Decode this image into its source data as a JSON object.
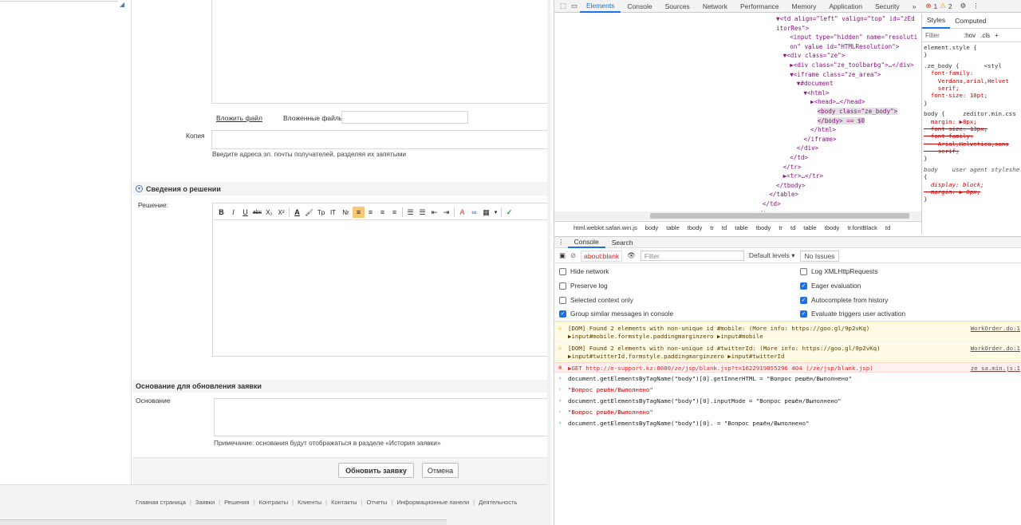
{
  "form": {
    "attach_link": "Вложить файл",
    "attached_files_label": "Вложенные файлы",
    "copy_label": "Копия",
    "copy_hint": "Введите адреса эл. почты получателей, разделяя их запятыми",
    "decision_section": "Сведения о решении",
    "decision_label": "Решение:",
    "editor_toolbar": [
      "B",
      "I",
      "U",
      "abc",
      "X₂",
      "X²",
      "A",
      "🖌",
      "Tp",
      "IT",
      "Nr",
      "≡",
      "≡",
      "≡",
      "≡",
      "☰",
      "☰",
      "⇤",
      "⇥",
      "A",
      "∞",
      "▦",
      "▾",
      "✓"
    ],
    "update_section": "Основание для обновления заявки",
    "reason_label": "Основание",
    "reason_hint": "Примечание: основания будут отображаться в разделе «История заявки»",
    "update_button": "Обновить заявку",
    "cancel_button": "Отмена"
  },
  "footer": {
    "links": [
      "Главная страница",
      "Заявки",
      "Решения",
      "Контракты",
      "Клиенты",
      "Контакты",
      "Отчеты",
      "Информационные панели",
      "Деятельность"
    ]
  },
  "devtools": {
    "tabs": [
      "Elements",
      "Console",
      "Sources",
      "Network",
      "Performance",
      "Memory",
      "Application",
      "Security",
      "»"
    ],
    "active_tab": "Elements",
    "error_count": "1",
    "warning_count": "2",
    "elements_lines": [
      {
        "indent": 0,
        "text": "▼<td align=\"left\" valign=\"top\" id=\"zEd"
      },
      {
        "indent": 0,
        "text": "itorRes\">"
      },
      {
        "indent": 2,
        "text": "<input type=\"hidden\" name=\"resoluti"
      },
      {
        "indent": 2,
        "text": "on\" value id=\"HTMLResolution\">"
      },
      {
        "indent": 1,
        "text": "▼<div class=\"ze\">"
      },
      {
        "indent": 2,
        "text": "▶<div class=\"ze_toolbarbg\">…</div>"
      },
      {
        "indent": 2,
        "text": "▼<iframe class=\"ze_area\">"
      },
      {
        "indent": 3,
        "text": "▼#document"
      },
      {
        "indent": 4,
        "text": "▼<html>"
      },
      {
        "indent": 5,
        "text": "▶<head>…</head>"
      },
      {
        "indent": 6,
        "text": "<body class=\"ze_body\">"
      },
      {
        "indent": 6,
        "text": "</body> == $0"
      },
      {
        "indent": 5,
        "text": "</html>"
      },
      {
        "indent": 4,
        "text": "</iframe>"
      },
      {
        "indent": 3,
        "text": "</div>"
      },
      {
        "indent": 2,
        "text": "</td>"
      },
      {
        "indent": 1,
        "text": "</tr>"
      },
      {
        "indent": 1,
        "text": "▶<tr>…</tr>"
      },
      {
        "indent": 0,
        "text": "</tbody>"
      },
      {
        "indent": -1,
        "text": "</table>"
      },
      {
        "indent": -2,
        "text": "</td>"
      },
      {
        "indent": -3,
        "text": "</tr>"
      }
    ],
    "breadcrumbs": [
      "html.webkit.safari.win.js",
      "body",
      "table",
      "tbody",
      "tr",
      "td",
      "table",
      "tbody",
      "tr",
      "td",
      "table",
      "tbody",
      "tr.fontBlack",
      "td"
    ],
    "styles_tabs": [
      "Styles",
      "Computed"
    ],
    "styles_filter": "Filter",
    "styles_hov": ":hov",
    "styles_cls": ".cls",
    "styles_lines": [
      "element.style {",
      "}",
      ".ze_body {       <styl",
      "  font-family:",
      "    Verdana,arial,Helvet",
      "    serif;",
      "  font-size: 10pt;",
      "}",
      "body {     zeditor.min.css",
      "  margin: ▶8px;",
      "  font-size: 13px;",
      "  font-family:",
      "    Arial,Helvetica,sans",
      "    serif;",
      "}",
      "body    user agent styleshe",
      "{",
      "  display: block;",
      "  margin: ▶ 8px;",
      "}"
    ],
    "console_tabs": [
      "Console",
      "Search"
    ],
    "context": "about:blank",
    "filter_placeholder": "Filter",
    "levels": "Default levels ▾",
    "issues": "No Issues",
    "settings": [
      {
        "label": "Hide network",
        "checked": false
      },
      {
        "label": "Log XMLHttpRequests",
        "checked": false
      },
      {
        "label": "Preserve log",
        "checked": false
      },
      {
        "label": "Eager evaluation",
        "checked": true
      },
      {
        "label": "Selected context only",
        "checked": false
      },
      {
        "label": "Autocomplete from history",
        "checked": true
      },
      {
        "label": "Group similar messages in console",
        "checked": true
      },
      {
        "label": "Evaluate triggers user activation",
        "checked": true
      }
    ],
    "messages": [
      {
        "type": "warn",
        "line1": "[DOM] Found 2 elements with non-unique id #mobile: (More info: https://goo.gl/9p2vKq)",
        "line2": "▶input#mobile.formstyle.paddingmarginzero  ▶input#mobile",
        "src": "WorkOrder.do:1"
      },
      {
        "type": "warn",
        "line1": "[DOM] Found 2 elements with non-unique id #twitterId: (More info: https://goo.gl/9p2vKq)",
        "line2": "▶input#twitterId.formstyle.paddingmarginzero  ▶input#twitterId",
        "src": "WorkOrder.do:1"
      },
      {
        "type": "err",
        "line1": "▶GET http://e-support.kz:8080/ze/jsp/blank.jsp?t=1622919855296 404 (/ze/jsp/blank.jsp)",
        "src": "ze_sa.min.js:1"
      },
      {
        "type": "in",
        "line1": "document.getElementsByTagName(\"body\")[0].getInnerHTML = \"Вопрос решён/Выполнено\""
      },
      {
        "type": "out",
        "line1": "\"Вопрос решён/Выполнено\""
      },
      {
        "type": "in",
        "line1": "document.getElementsByTagName(\"body\")[0].inputMode = \"Вопрос решён/Выполнено\""
      },
      {
        "type": "out",
        "line1": "\"Вопрос решён/Выполнено\""
      },
      {
        "type": "in",
        "line1": "document.getElementsByTagName(\"body\")[0]. = \"Вопрос решён/Выполнено\""
      }
    ]
  }
}
